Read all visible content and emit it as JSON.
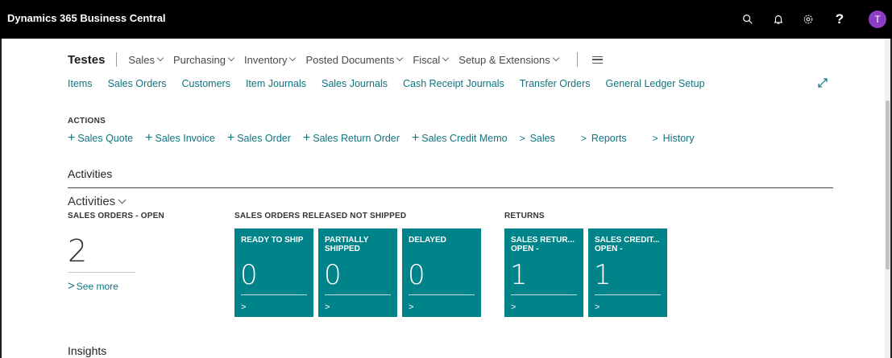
{
  "app": {
    "title": "Dynamics 365 Business Central",
    "avatar_initial": "T"
  },
  "nav": {
    "company": "Testes",
    "items": [
      "Sales",
      "Purchasing",
      "Inventory",
      "Posted Documents",
      "Fiscal",
      "Setup & Extensions"
    ]
  },
  "links": [
    "Items",
    "Sales Orders",
    "Customers",
    "Item Journals",
    "Sales Journals",
    "Cash Receipt Journals",
    "Transfer Orders",
    "General Ledger Setup"
  ],
  "actions": {
    "label": "ACTIONS",
    "new_items": [
      "Sales Quote",
      "Sales Invoice",
      "Sales Order",
      "Sales Return Order",
      "Sales Credit Memo"
    ],
    "expand_items": [
      "Sales",
      "Reports",
      "History"
    ]
  },
  "activities": {
    "section_title": "Activities",
    "collapse_title": "Activities",
    "sales_orders_open": {
      "label": "SALES ORDERS - OPEN",
      "value": "2",
      "see_more": "See more"
    },
    "group_released": {
      "label": "SALES ORDERS RELEASED NOT SHIPPED"
    },
    "group_returns": {
      "label": "RETURNS"
    },
    "tiles": [
      {
        "label": "READY TO SHIP",
        "value": "0"
      },
      {
        "label": "PARTIALLY SHIPPED",
        "value": "0"
      },
      {
        "label": "DELAYED",
        "value": "0"
      },
      {
        "label": "SALES RETUR... OPEN -",
        "value": "1"
      },
      {
        "label": "SALES CREDIT... OPEN -",
        "value": "1"
      }
    ]
  },
  "insights": {
    "title": "Insights"
  },
  "colors": {
    "topbar": "#000000",
    "accent": "#0e7480",
    "tile": "#008489",
    "avatar": "#8b3ec4"
  }
}
